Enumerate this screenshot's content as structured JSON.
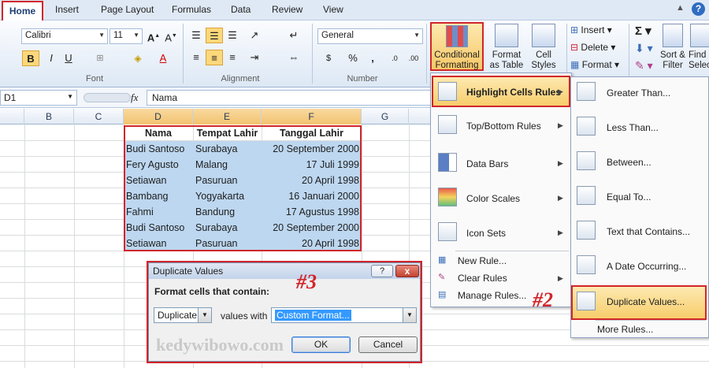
{
  "tabs": [
    "Home",
    "Insert",
    "Page Layout",
    "Formulas",
    "Data",
    "Review",
    "View"
  ],
  "ribbon": {
    "font_name": "Calibri",
    "font_size": "11",
    "number_format": "General",
    "groups": [
      "Font",
      "Alignment",
      "Number"
    ],
    "conditional_formatting": "Conditional Formatting",
    "format_as_table": "Format as Table",
    "cell_styles": "Cell Styles",
    "insert": "Insert",
    "delete": "Delete",
    "format": "Format",
    "sort_filter": "Sort & Filter",
    "find_select": "Find & Select",
    "bold": "B",
    "italic": "I",
    "underline": "U"
  },
  "formula_bar": {
    "name_box": "D1",
    "fx": "fx",
    "content": "Nama"
  },
  "columns": [
    "B",
    "C",
    "D",
    "E",
    "F",
    "G"
  ],
  "table": {
    "headers": [
      "Nama",
      "Tempat Lahir",
      "Tanggal Lahir"
    ],
    "rows": [
      [
        "Budi Santoso",
        "Surabaya",
        "20 September 2000"
      ],
      [
        "Fery Agusto",
        "Malang",
        "17 Juli 1999"
      ],
      [
        "Setiawan",
        "Pasuruan",
        "20 April 1998"
      ],
      [
        "Bambang",
        "Yogyakarta",
        "16 Januari 2000"
      ],
      [
        "Fahmi",
        "Bandung",
        "17 Agustus 1998"
      ],
      [
        "Budi Santoso",
        "Surabaya",
        "20 September 2000"
      ],
      [
        "Setiawan",
        "Pasuruan",
        "20 April 1998"
      ]
    ]
  },
  "cf_menu": {
    "items": [
      "Highlight Cells Rules",
      "Top/Bottom Rules",
      "Data Bars",
      "Color Scales",
      "Icon Sets"
    ],
    "lower": [
      "New Rule...",
      "Clear Rules",
      "Manage Rules..."
    ]
  },
  "highlight_menu": {
    "items": [
      "Greater Than...",
      "Less Than...",
      "Between...",
      "Equal To...",
      "Text that Contains...",
      "A Date Occurring...",
      "Duplicate Values..."
    ],
    "more": "More Rules..."
  },
  "dialog": {
    "title": "Duplicate Values",
    "prompt": "Format cells that contain:",
    "type_value": "Duplicate",
    "values_with": "values with",
    "format_value": "Custom Format...",
    "ok": "OK",
    "cancel": "Cancel",
    "help": "?",
    "close": "x"
  },
  "annotations": {
    "n2": "#2",
    "n3": "#3"
  },
  "watermark": "kedywibowo.com",
  "colors": {
    "accent_red": "#d1262b",
    "selection_blue": "#bdd7f0",
    "header_highlight": "#f2c36f"
  }
}
